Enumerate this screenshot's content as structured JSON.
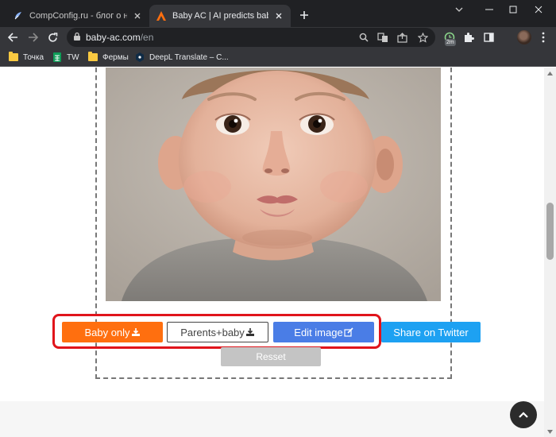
{
  "browser": {
    "tabs": [
      {
        "title": "CompConfig.ru - блог о настройке",
        "favicon": "compconfig-favicon",
        "active": false
      },
      {
        "title": "Baby AC  |  AI predicts baby's face",
        "favicon": "baby-ac-favicon",
        "active": true
      }
    ],
    "url": {
      "host": "baby-ac.com",
      "path": "/en"
    },
    "extension_badge": "2m",
    "bookmarks": [
      {
        "label": "Точка",
        "icon": "folder-icon"
      },
      {
        "label": "TW",
        "icon": "sheets-icon"
      },
      {
        "label": "Фермы",
        "icon": "folder-icon"
      },
      {
        "label": "DeepL Translate – С...",
        "icon": "deepl-icon"
      }
    ]
  },
  "page": {
    "photo": "generated-baby-face",
    "buttons": {
      "baby_only": "Baby only",
      "parents_baby": "Parents+baby",
      "edit_image": "Edit image",
      "share_twitter": "Share on Twitter",
      "reset": "Resset"
    }
  },
  "colors": {
    "baby_only": "#ff6f0f",
    "edit_image": "#4a7de6",
    "twitter": "#1da1f2",
    "reset": "#c4c4c4",
    "highlight": "#e0141b"
  }
}
